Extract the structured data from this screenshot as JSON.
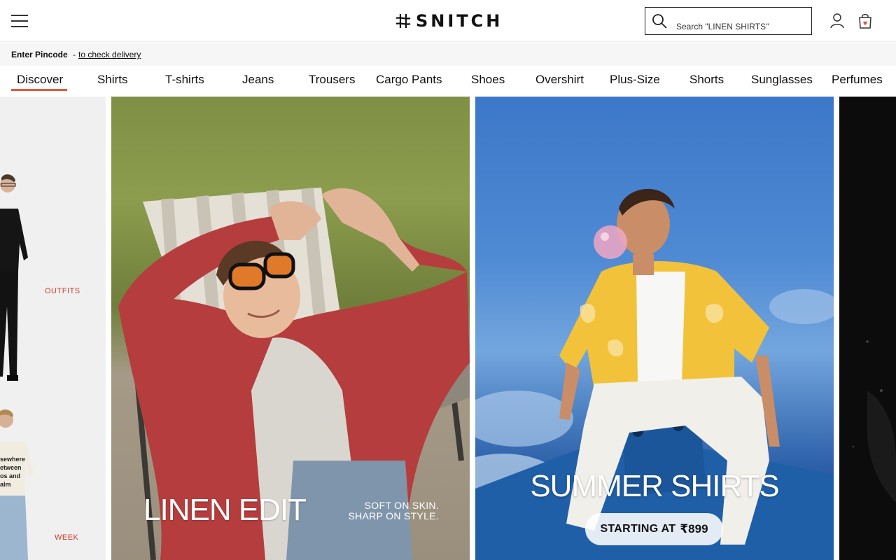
{
  "header": {
    "brand": "SNITCH",
    "search_placeholder": "Search \"LINEN SHIRTS\""
  },
  "pincode": {
    "label": "Enter Pincode",
    "separator": "-",
    "link": "to check delivery"
  },
  "categories": [
    {
      "label": "Discover",
      "active": true
    },
    {
      "label": "Shirts"
    },
    {
      "label": "T-shirts"
    },
    {
      "label": "Jeans"
    },
    {
      "label": "Trousers"
    },
    {
      "label": "Cargo Pants"
    },
    {
      "label": "Shoes"
    },
    {
      "label": "Overshirt"
    },
    {
      "label": "Plus-Size"
    },
    {
      "label": "Shorts"
    },
    {
      "label": "Sunglasses"
    },
    {
      "label": "Perfumes"
    }
  ],
  "banners": {
    "left": {
      "tag_top": "OUTFITS",
      "tag_bottom": "WEEK",
      "tee_text": [
        "sewhere",
        "etween",
        "os and",
        "alm"
      ]
    },
    "linen": {
      "title": "LINEN EDIT",
      "sub1": "SOFT ON SKIN.",
      "sub2": "SHARP ON STYLE."
    },
    "summer": {
      "title": "SUMMER SHIRTS",
      "pill_text": "STARTING AT",
      "pill_price": "₹899"
    }
  },
  "colors": {
    "accent": "#e25b3a",
    "tag_red": "#d03a2a"
  }
}
